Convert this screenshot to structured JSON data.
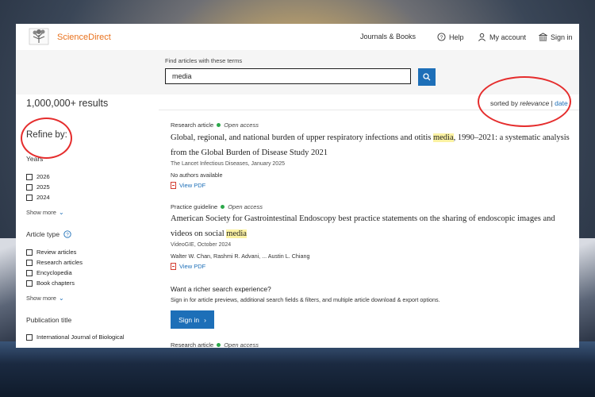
{
  "brand": {
    "name": "ScienceDirect",
    "logo_icon": "elsevier-tree-icon",
    "accent": "#e9711c"
  },
  "nav": {
    "journals_books": "Journals & Books",
    "help": "Help",
    "my_account": "My account",
    "sign_in": "Sign in"
  },
  "search": {
    "label": "Find articles with these terms",
    "value": "media",
    "button_icon": "search-icon"
  },
  "results": {
    "count": "1,000,000+ results",
    "sort_prefix": "sorted by",
    "sort_relevance": "relevance",
    "sort_sep": "|",
    "sort_date": "date"
  },
  "sidebar": {
    "refine": "Refine by:",
    "years": {
      "heading": "Years",
      "options": [
        "2026",
        "2025",
        "2024"
      ],
      "show_more": "Show more"
    },
    "article_type": {
      "heading": "Article type",
      "options": [
        "Review articles",
        "Research articles",
        "Encyclopedia",
        "Book chapters"
      ],
      "show_more": "Show more"
    },
    "publication_title": {
      "heading": "Publication title",
      "options": [
        "International Journal of Biological"
      ]
    }
  },
  "articles": [
    {
      "type": "Research article",
      "access": "Open access",
      "title_before": "Global, regional, and national burden of upper respiratory infections and otitis ",
      "title_highlight": "media",
      "title_after": ", 1990–2021: a systematic analysis from the Global Burden of Disease Study 2021",
      "source": "The Lancet Infectious Diseases, January 2025",
      "authors": "No authors available",
      "pdf": "View PDF"
    },
    {
      "type": "Practice guideline",
      "access": "Open access",
      "title_before": "American Society for Gastrointestinal Endoscopy best practice statements on the sharing of endoscopic images and videos on social ",
      "title_highlight": "media",
      "title_after": "",
      "source": "VideoGIE, October 2024",
      "authors": "Walter W. Chan, Rashmi R. Advani, ... Austin L. Chiang",
      "pdf": "View PDF"
    },
    {
      "type": "Research article",
      "access": "Open access"
    }
  ],
  "promo": {
    "heading": "Want a richer search experience?",
    "text": "Sign in for article previews, additional search fields & filters, and multiple article download & export options.",
    "button": "Sign in"
  },
  "colors": {
    "link": "#1d6fb8",
    "open_access_dot": "#2ba84a",
    "highlight": "#fbf2a3",
    "annotation": "#e52d2d"
  }
}
